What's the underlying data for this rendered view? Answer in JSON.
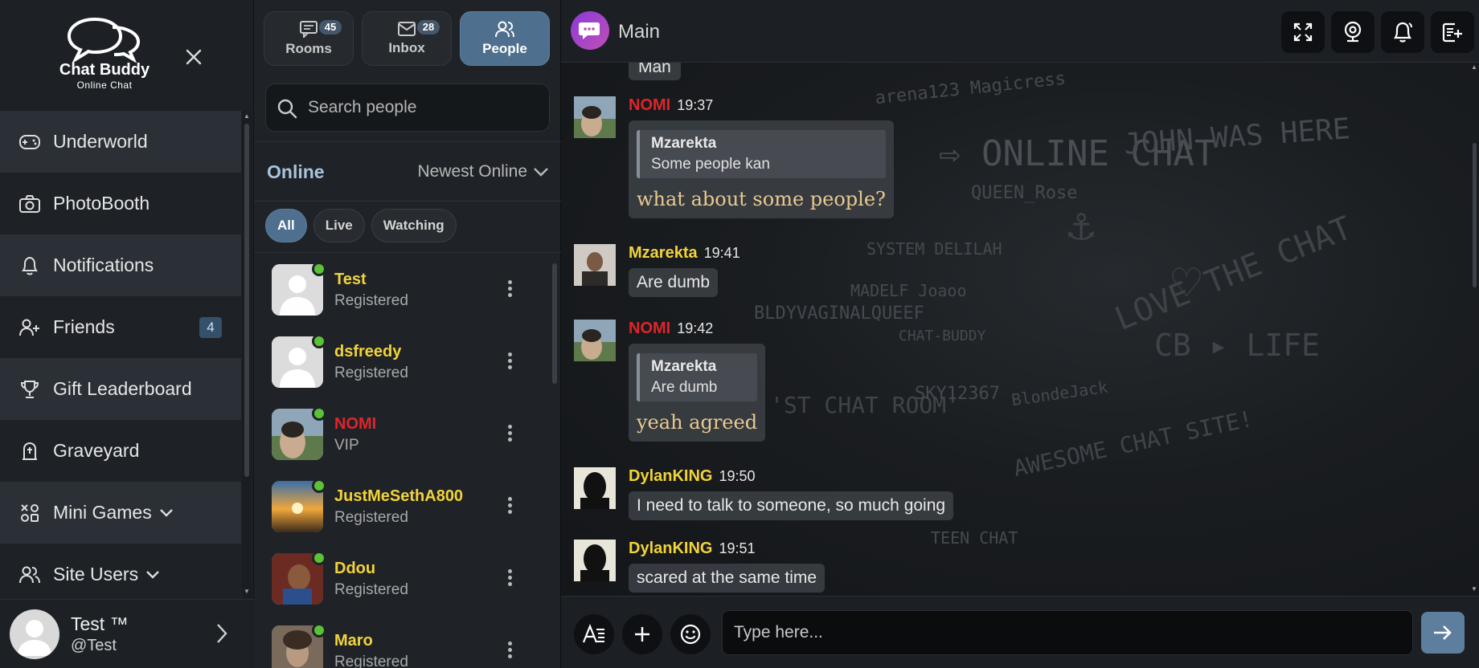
{
  "brand": {
    "title": "Chat Buddy",
    "subtitle": "Online Chat"
  },
  "nav": [
    {
      "label": "Underworld",
      "icon": "gamepad-icon"
    },
    {
      "label": "PhotoBooth",
      "icon": "camera-icon"
    },
    {
      "label": "Notifications",
      "icon": "bell-icon"
    },
    {
      "label": "Friends",
      "icon": "add-user-icon",
      "badge": "4"
    },
    {
      "label": "Gift Leaderboard",
      "icon": "trophy-icon"
    },
    {
      "label": "Graveyard",
      "icon": "tombstone-icon"
    },
    {
      "label": "Mini Games",
      "icon": "games-icon"
    },
    {
      "label": "Site Users",
      "icon": "users-icon"
    }
  ],
  "current_user": {
    "name": "Test ™",
    "handle": "@Test"
  },
  "tabs": [
    {
      "label": "Rooms",
      "count": "45",
      "icon": "chat-icon"
    },
    {
      "label": "Inbox",
      "count": "28",
      "icon": "mail-icon"
    },
    {
      "label": "People",
      "count": "",
      "icon": "people-icon"
    }
  ],
  "search": {
    "placeholder": "Search people"
  },
  "online": {
    "label": "Online",
    "sort": "Newest Online"
  },
  "filters": [
    "All",
    "Live",
    "Watching"
  ],
  "people": [
    {
      "name": "Test",
      "rank": "Registered",
      "vip": false
    },
    {
      "name": "dsfreedy",
      "rank": "Registered",
      "vip": false
    },
    {
      "name": "NOMI",
      "rank": "VIP",
      "vip": true
    },
    {
      "name": "JustMeSethA800",
      "rank": "Registered",
      "vip": false
    },
    {
      "name": "Ddou",
      "rank": "Registered",
      "vip": false
    },
    {
      "name": "Maro",
      "rank": "Registered",
      "vip": false
    }
  ],
  "chat": {
    "room": "Main",
    "partial_text": "Man",
    "messages": [
      {
        "user": "NOMI",
        "time": "19:37",
        "vip": true,
        "quote_user": "Mzarekta",
        "quote_text": "Some people kan",
        "text": "what about some people?"
      },
      {
        "user": "Mzarekta",
        "time": "19:41",
        "vip": false,
        "text": "Are dumb"
      },
      {
        "user": "NOMI",
        "time": "19:42",
        "vip": true,
        "quote_user": "Mzarekta",
        "quote_text": "Are dumb",
        "text": "yeah agreed"
      },
      {
        "user": "DylanKING",
        "time": "19:50",
        "vip": false,
        "text": "I need to talk to someone, so much going"
      },
      {
        "user": "DylanKING",
        "time": "19:51",
        "vip": false,
        "text": "scared at the same time"
      }
    ],
    "composer_placeholder": "Type here..."
  },
  "colors": {
    "accent": "#4e6f8d",
    "vip": "#e0242a",
    "registered": "#f2d33a",
    "online": "#5bc236"
  }
}
